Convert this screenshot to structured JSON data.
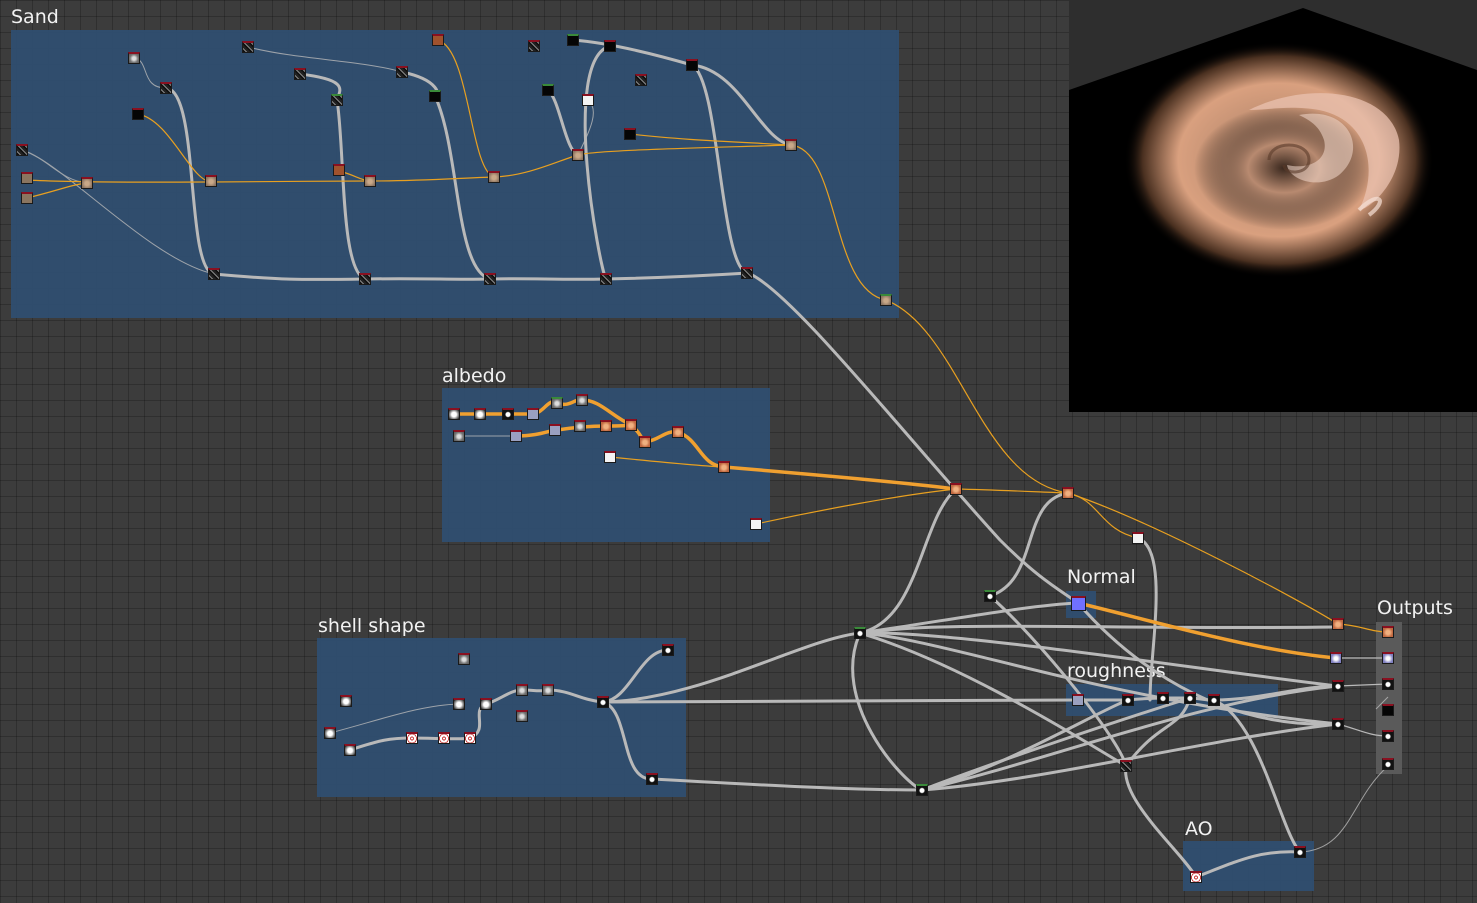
{
  "frames": {
    "sand": {
      "title": "Sand"
    },
    "albedo": {
      "title": "albedo"
    },
    "shell_shape": {
      "title": "shell shape"
    },
    "normal": {
      "title": "Normal"
    },
    "roughness": {
      "title": "roughness"
    },
    "ao": {
      "title": "AO"
    },
    "outputs": {
      "title": "Outputs"
    }
  },
  "colors": {
    "canvas": "#3c3c3c",
    "frame": "#2f4d6e",
    "wire": "#b8b8b8",
    "wire_color": "#e8a020",
    "preview_bg": "#000000"
  },
  "icons": [
    "node-thumbnail-icon",
    "output-port-icon"
  ]
}
